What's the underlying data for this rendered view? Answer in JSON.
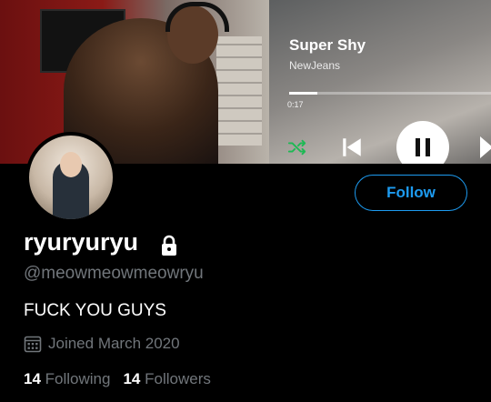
{
  "banner": {
    "player": {
      "song_title": "Super Shy",
      "artist": "NewJeans",
      "elapsed": "0:17",
      "progress": 0.14,
      "accent_color": "#1db954"
    }
  },
  "profile": {
    "follow_label": "Follow",
    "display_name": "ryuryuryu",
    "handle": "@meowmeowmeowryu",
    "bio": "FUCK YOU GUYS",
    "joined": "Joined March 2020",
    "following_count": "14",
    "following_label": "Following",
    "followers_count": "14",
    "followers_label": "Followers",
    "protected_icon": "lock-icon",
    "calendar_icon": "calendar-icon"
  },
  "colors": {
    "background": "#000000",
    "text": "#e7e9ea",
    "secondary_text": "#71767b",
    "accent": "#1d9bf0"
  }
}
